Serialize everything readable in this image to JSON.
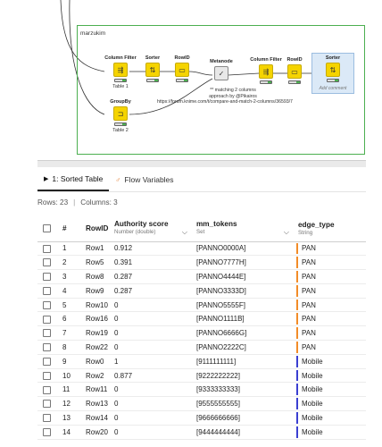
{
  "workflow": {
    "annotation_label": "marzukim",
    "colors": {
      "annotation_border": "#4caf50",
      "node_body": "#f5d400",
      "connection": "#333333",
      "selected_bg": "#dbe9f7"
    },
    "nodes": [
      {
        "id": "cf1",
        "title": "Column Filter",
        "caption": "Table 1",
        "icon": "column-filter-icon",
        "glyph": "⇶"
      },
      {
        "id": "sorter1",
        "title": "Sorter",
        "caption": "",
        "icon": "sorter-icon",
        "glyph": "⇅"
      },
      {
        "id": "rowid1",
        "title": "RowID",
        "caption": "",
        "icon": "rowid-icon",
        "glyph": "▭"
      },
      {
        "id": "groupby",
        "title": "GroupBy",
        "caption": "Table 2",
        "icon": "groupby-icon",
        "glyph": "⊐"
      },
      {
        "id": "metanode",
        "title": "Metanode",
        "caption": "",
        "icon": "metanode-icon",
        "glyph": "✓"
      },
      {
        "id": "cf2",
        "title": "Column Filter",
        "caption": "",
        "icon": "column-filter-icon",
        "glyph": "⇶"
      },
      {
        "id": "rowid2",
        "title": "RowID",
        "caption": "",
        "icon": "rowid-icon",
        "glyph": "▭"
      },
      {
        "id": "sorter2",
        "title": "Sorter",
        "caption": "Add comment",
        "icon": "sorter-icon",
        "glyph": "⇅"
      }
    ],
    "metanode_note": {
      "line1": "** matching 2 columns",
      "line2": "approach by @Pikairos",
      "line3": "https://forum.knime.com/t/compare-and-match-2-columns/36593/7"
    }
  },
  "panel": {
    "tabs": [
      {
        "label": "1: Sorted Table",
        "active": true
      },
      {
        "label": "Flow Variables",
        "active": false
      }
    ],
    "summary": {
      "rows": "Rows: 23",
      "columns": "Columns: 3"
    }
  },
  "table": {
    "headers": {
      "index": "#",
      "rowid": "RowID",
      "authority": "Authority score",
      "authority_type": "Number (double)",
      "tokens": "mm_tokens",
      "tokens_type": "Set",
      "edge": "edge_type",
      "edge_type": "String"
    },
    "edge_colors": {
      "PAN": "#f28c28",
      "Mobile": "#3a3fd1"
    },
    "rows": [
      {
        "idx": "1",
        "rowid": "Row1",
        "auth": "0.912",
        "tokens": "[PANNO0000A]",
        "edge": "PAN"
      },
      {
        "idx": "2",
        "rowid": "Row5",
        "auth": "0.391",
        "tokens": "[PANNO7777H]",
        "edge": "PAN"
      },
      {
        "idx": "3",
        "rowid": "Row8",
        "auth": "0.287",
        "tokens": "[PANNO4444E]",
        "edge": "PAN"
      },
      {
        "idx": "4",
        "rowid": "Row9",
        "auth": "0.287",
        "tokens": "[PANNO3333D]",
        "edge": "PAN"
      },
      {
        "idx": "5",
        "rowid": "Row10",
        "auth": "0",
        "tokens": "[PANNO5555F]",
        "edge": "PAN"
      },
      {
        "idx": "6",
        "rowid": "Row16",
        "auth": "0",
        "tokens": "[PANNO1111B]",
        "edge": "PAN"
      },
      {
        "idx": "7",
        "rowid": "Row19",
        "auth": "0",
        "tokens": "[PANNO6666G]",
        "edge": "PAN"
      },
      {
        "idx": "8",
        "rowid": "Row22",
        "auth": "0",
        "tokens": "[PANNO2222C]",
        "edge": "PAN"
      },
      {
        "idx": "9",
        "rowid": "Row0",
        "auth": "1",
        "tokens": "[9111111111]",
        "edge": "Mobile"
      },
      {
        "idx": "10",
        "rowid": "Row2",
        "auth": "0.877",
        "tokens": "[9222222222]",
        "edge": "Mobile"
      },
      {
        "idx": "11",
        "rowid": "Row11",
        "auth": "0",
        "tokens": "[9333333333]",
        "edge": "Mobile"
      },
      {
        "idx": "12",
        "rowid": "Row13",
        "auth": "0",
        "tokens": "[9555555555]",
        "edge": "Mobile"
      },
      {
        "idx": "13",
        "rowid": "Row14",
        "auth": "0",
        "tokens": "[9666666666]",
        "edge": "Mobile"
      },
      {
        "idx": "14",
        "rowid": "Row20",
        "auth": "0",
        "tokens": "[9444444444]",
        "edge": "Mobile"
      }
    ]
  }
}
